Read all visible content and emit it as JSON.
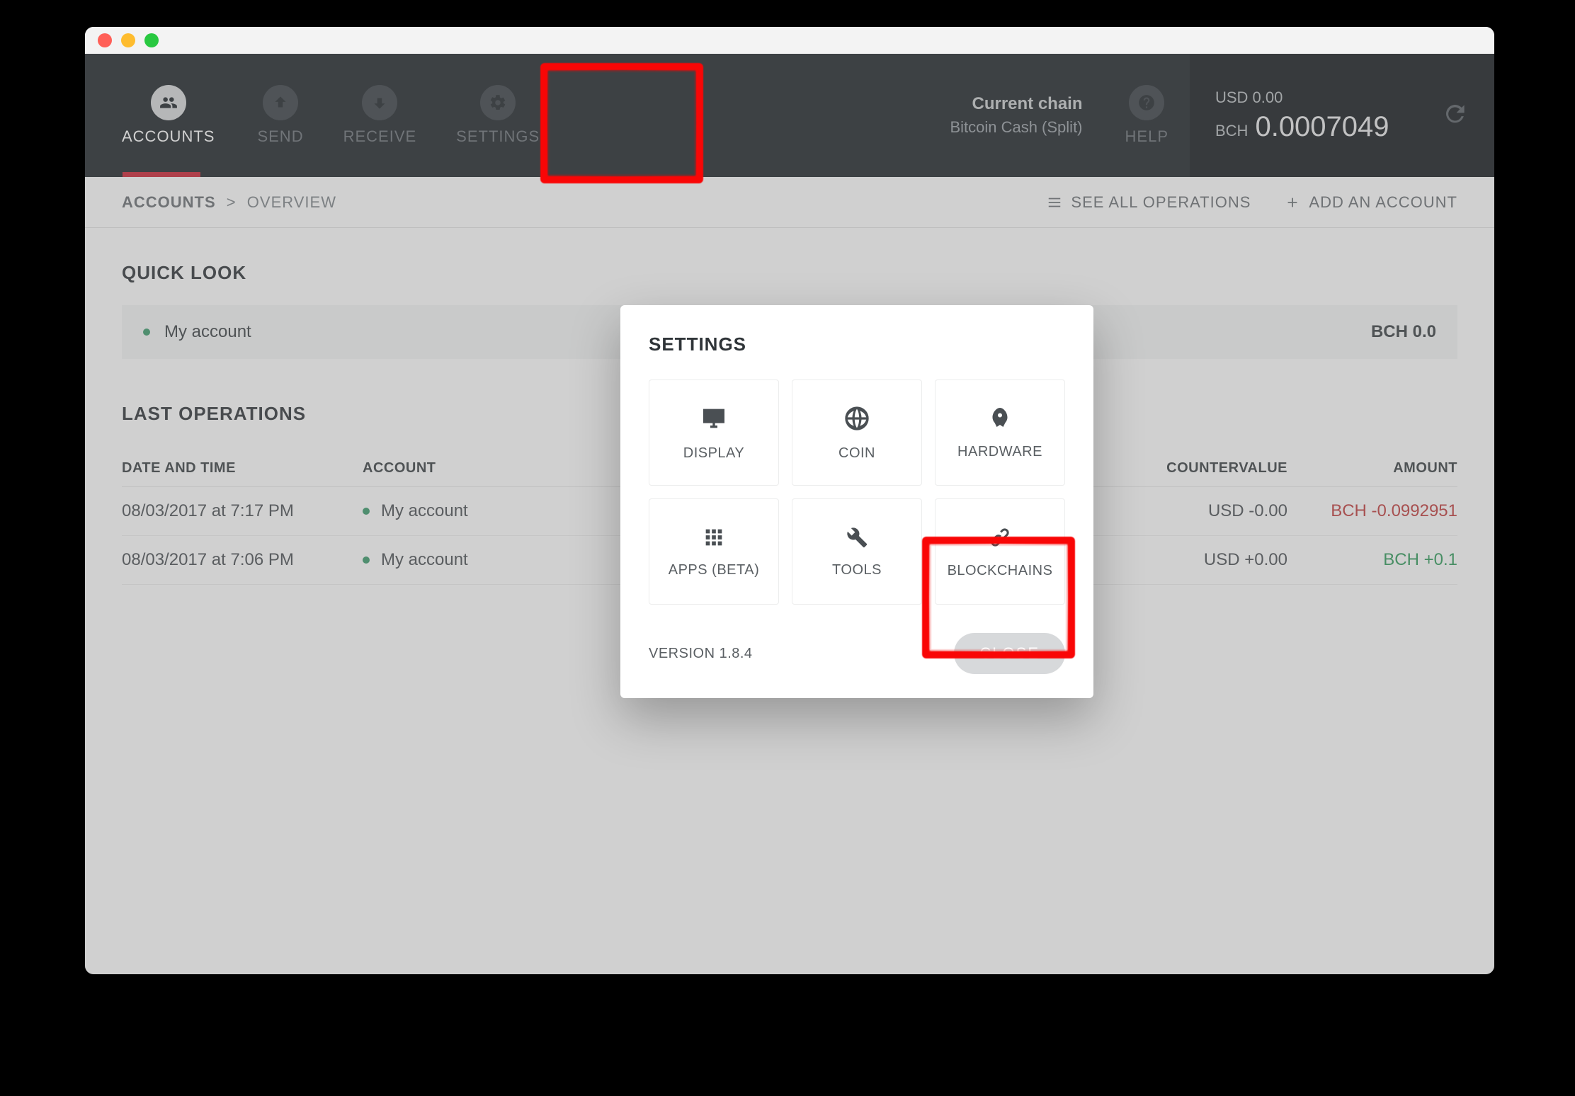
{
  "nav": {
    "items": [
      {
        "label": "ACCOUNTS"
      },
      {
        "label": "SEND"
      },
      {
        "label": "RECEIVE"
      },
      {
        "label": "SETTINGS"
      },
      {
        "label": "HELP"
      }
    ]
  },
  "chain": {
    "title": "Current chain",
    "name": "Bitcoin Cash (Split)"
  },
  "balance": {
    "usd": "USD 0.00",
    "bch_label": "BCH",
    "bch_value": "0.0007049"
  },
  "breadcrumb": {
    "root": "ACCOUNTS",
    "sep": ">",
    "leaf": "OVERVIEW"
  },
  "subbar": {
    "see_all": "SEE ALL OPERATIONS",
    "add_account": "ADD AN ACCOUNT"
  },
  "quick_look": {
    "heading": "QUICK LOOK",
    "account_name": "My account",
    "account_balance": "BCH 0.0"
  },
  "operations": {
    "heading": "LAST OPERATIONS",
    "cols": {
      "date": "DATE AND TIME",
      "account": "ACCOUNT",
      "countervalue": "COUNTERVALUE",
      "amount": "AMOUNT"
    },
    "rows": [
      {
        "date": "08/03/2017 at 7:17 PM",
        "account": "My account",
        "countervalue": "USD -0.00",
        "amount": "BCH -0.0992951",
        "sign": "neg"
      },
      {
        "date": "08/03/2017 at 7:06 PM",
        "account": "My account",
        "countervalue": "USD +0.00",
        "amount": "BCH +0.1",
        "sign": "pos"
      }
    ]
  },
  "modal": {
    "title": "SETTINGS",
    "tiles": [
      {
        "label": "DISPLAY"
      },
      {
        "label": "COIN"
      },
      {
        "label": "HARDWARE"
      },
      {
        "label": "APPS (BETA)"
      },
      {
        "label": "TOOLS"
      },
      {
        "label": "BLOCKCHAINS"
      }
    ],
    "version": "VERSION 1.8.4",
    "close": "CLOSE"
  }
}
